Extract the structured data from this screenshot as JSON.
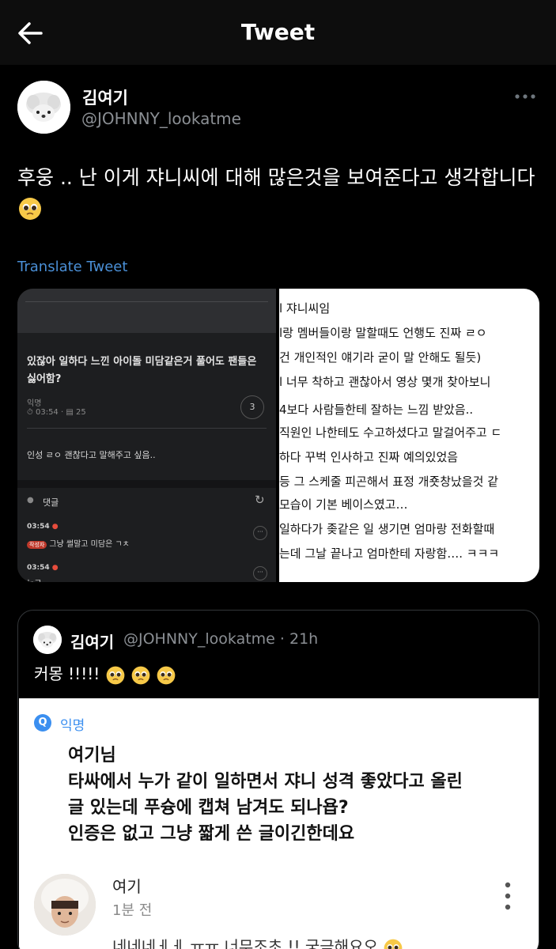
{
  "header": {
    "title": "Tweet"
  },
  "tweet": {
    "name": "김여기",
    "handle": "@JOHNNY_lookatme",
    "text": "후웅 .. 난 이게 쟈니씨에 대해 많은것을 보여준다고 생각합니다",
    "translate": "Translate Tweet"
  },
  "media_left": {
    "post_title": "있잖아 일하다 느낀 아이돌 미담같은거 풀어도 팬들은 싫어함?",
    "author": "익명",
    "meta": "⏱ 03:54 · ▤ 25",
    "count": "3",
    "body": "인성 ㄹㅇ 괜찮다고 말해주고 싶음..",
    "comments_label": "댓글",
    "comment1_time": "03:54",
    "comment1_badge": "작성자",
    "comment1_text": "그냥 썰말고 미담은 ㄱㅊ",
    "comment2_time": "03:54",
    "comment2_text": "누구"
  },
  "media_right": {
    "lines": [
      "l 쟈니씨임",
      "l랑 멤버들이랑 말할때도 언행도 진짜 ㄹㅇ",
      "건 개인적인 얘기라 굳이 말 안해도 될듯)",
      "l 너무 착하고 괜찮아서 영상 몇개 찾아보니",
      "4보다 사람들한테 잘하는 느낌 받았음..",
      "직원인 나한테도 수고하셨다고 말걸어주고 ㄷ",
      "하다 꾸벅 인사하고 진짜 예의있었음",
      "등 그 스케줄 피곤해서 표정 개죳창났을것 같",
      "모습이 기본 베이스였고…",
      "일하다가 좆같은 일 생기면 엄마랑 전화할때",
      "는데 그날 끝나고 엄마한테 자랑함…. ㅋㅋㅋ"
    ]
  },
  "quote": {
    "name": "김여기",
    "handle_time": "@JOHNNY_lookatme · 21h",
    "text": "커몽 !!!!!",
    "card": {
      "icon": "Q",
      "source": "익명",
      "question_lines": [
        "여기님",
        "타싸에서 누가 같이 일하면서 쟈니 성격 좋았다고 올린",
        "글 있는데 푸슝에 캡쳐 남겨도 되나욥?",
        "인증은 없고 그냥 짧게 쓴 글이긴한데요"
      ],
      "user": "여기",
      "time": "1분 전",
      "reply": "네네네ㅔㅔ ㅠㅠ 너무조초 !! 궁금해요오"
    }
  },
  "icons": {
    "back": "back-arrow-icon",
    "more": "more-horizontal-icon",
    "emoji": "pleading-face-emoji"
  },
  "colors": {
    "link": "#4a8fd6",
    "quote_source": "#3b8ff0",
    "background": "#000000"
  }
}
